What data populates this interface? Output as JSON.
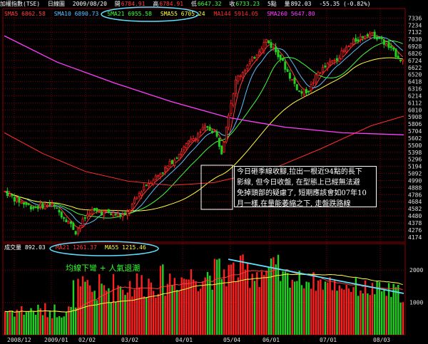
{
  "header": {
    "index_name": "加權指數(TSE)",
    "period": "日線圖",
    "date": "2009/08/20",
    "open_label": "開",
    "open": "6784.91",
    "high_label": "高",
    "high": "6784.91",
    "low_label": "低",
    "low": "6647.32",
    "close_label": "收",
    "close": "6733.23",
    "unit": "5點",
    "volume_label": "量",
    "volume": "892.03",
    "change": "-55.35 (-0.82%)"
  },
  "ma_legend": [
    {
      "label": "SMA5",
      "value": "6862.58",
      "color": "#ff4040"
    },
    {
      "label": "SMA10",
      "value": "6890.73",
      "color": "#60c0ff"
    },
    {
      "label": "SMA21",
      "value": "6955.58",
      "color": "#40ff40"
    },
    {
      "label": "SMA55",
      "value": "6705.24",
      "color": "#ffff40"
    },
    {
      "label": "MA144",
      "value": "5914.05",
      "color": "#ff3030"
    },
    {
      "label": "SMA260",
      "value": "5647.80",
      "color": "#ff40ff"
    }
  ],
  "volume_legend": {
    "title": "成交量",
    "value": "892.03",
    "ma21_label": "MA21",
    "ma21_value": "1261.37",
    "ma55_label": "MA55",
    "ma55_value": "1215.46"
  },
  "annotation": {
    "lines": [
      "今日砸季線收腳,拉出一根近94點的長下",
      "影線, 但今日收盤, 在型態上已經無法避",
      "免掉頭部的疑慮了, 短期應該會如07年10",
      "月一樣,在量能萎縮之下, 走盤跌路線"
    ]
  },
  "volume_caption": "均線下彎 + 人氣退潮",
  "colors": {
    "up": "#ff2020",
    "down": "#20d020",
    "grid": "#7a0000",
    "axis_text": "#e0e0e0",
    "highlight_ellipse": "#60e0ff",
    "trend_line": "#60e0ff"
  },
  "chart_data": {
    "type": "candlestick",
    "y_axis_ticks": [
      "7336",
      "7234",
      "7132",
      "7030",
      "6928",
      "6826",
      "6724",
      "6622",
      "6520",
      "6418",
      "6316",
      "6214",
      "6112",
      "6010",
      "5908",
      "5806",
      "5704",
      "5602",
      "5500",
      "5398",
      "5296",
      "5194",
      "5092",
      "4990",
      "4888",
      "4786",
      "4684",
      "4582",
      "4480",
      "4378",
      "4276",
      "4174",
      "4072"
    ],
    "volume_axis_ticks": [
      "2000",
      "1000"
    ],
    "x_axis_ticks": [
      "2008/12",
      "2009/01",
      "02/02",
      "03/02",
      "04/01",
      "05/04",
      "06/01",
      "07/01",
      "08/03"
    ],
    "ylim": [
      4100,
      7350
    ],
    "last_close": 6733.23,
    "volume_last": 892.03,
    "moving_averages": {
      "SMA5_last": 6862.58,
      "SMA10_last": 6890.73,
      "SMA21_last": 6955.58,
      "SMA55_last": 6705.24,
      "MA144_last": 5914.05,
      "SMA260_last": 5647.8
    }
  }
}
